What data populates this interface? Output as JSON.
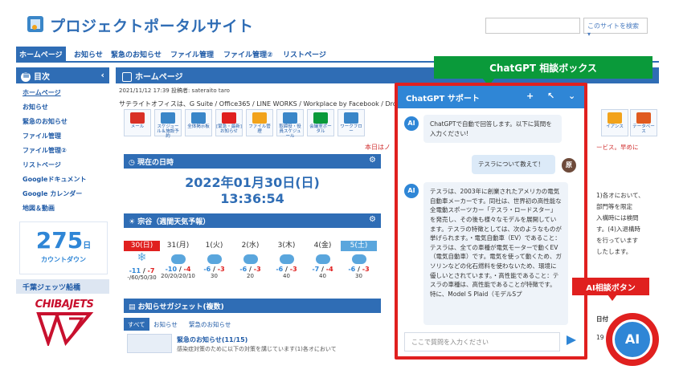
{
  "header": {
    "site_title": "プロジェクトポータルサイト",
    "search_scope": "このサイトを検索 ▾"
  },
  "nav": {
    "items": [
      "ホームページ",
      "お知らせ",
      "緊急のお知らせ",
      "ファイル管理",
      "ファイル管理②",
      "リストページ"
    ],
    "active_index": 0
  },
  "sidebar": {
    "title": "目次",
    "links": [
      "ホームページ",
      "お知らせ",
      "緊急のお知らせ",
      "ファイル管理",
      "ファイル管理②",
      "リストページ",
      "Googleドキュメント",
      "Google カレンダー",
      "地図＆動画"
    ],
    "countdown": {
      "number": "275",
      "unit": "日",
      "label": "カウントダウン"
    },
    "team_title": "千葉ジェッツ船橋",
    "team_logo_text": "CHIBAJETS"
  },
  "main": {
    "title": "ホームページ",
    "post_meta": "2021/11/12 17:39 投稿者: sateraito taro",
    "lead": "サテライトオフィスは、G Suite / Office365 / LINE WORKS / Workplace by Facebook / Drop",
    "apps": [
      "メール",
      "スケジュール＆施設予約",
      "全体掲示板",
      "[緊急・最新]お知らせ",
      "ファイル管理",
      "取締役・役員スケジュール",
      "会議室ポータル",
      "ワークフロー"
    ],
    "notice_red": "本日はノ",
    "clock": {
      "title": "現在の日時",
      "date": "2022年01月30日(日)",
      "time": "13:36:54"
    },
    "weather": {
      "title": "宗谷（週間天気予報）",
      "days": [
        {
          "day": "30(日)",
          "temp_max": "-11",
          "temp_min": "-7",
          "pop": "-/60/50/30"
        },
        {
          "day": "31(月)",
          "temp_max": "-10",
          "temp_min": "-4",
          "pop": "20/20/20/10"
        },
        {
          "day": "1(火)",
          "temp_max": "-6",
          "temp_min": "-3",
          "pop": "30"
        },
        {
          "day": "2(水)",
          "temp_max": "-6",
          "temp_min": "-3",
          "pop": "20"
        },
        {
          "day": "3(木)",
          "temp_max": "-6",
          "temp_min": "-3",
          "pop": "40"
        },
        {
          "day": "4(金)",
          "temp_max": "-7",
          "temp_min": "-4",
          "pop": "40"
        },
        {
          "day": "5(土)",
          "temp_max": "-6",
          "temp_min": "-3",
          "pop": "30"
        }
      ]
    },
    "news": {
      "title": "お知らせガジェット(複数)",
      "tabs": [
        "すべて",
        "お知らせ",
        "緊急のお知らせ"
      ],
      "item_title": "緊急のお知らせ(11/15)",
      "item_body": "感染症対策のために以下の対策を講じています(1)各オにおいて"
    },
    "right_column": [
      "イアンス",
      "テータベース",
      "ービス。早めに",
      "1)各オにおいて、",
      "部門等を限定",
      "入構時には検問",
      "す。(4)入退構時",
      "を行っています",
      "したします。",
      "日付",
      "19"
    ]
  },
  "callouts": {
    "chat_box": "ChatGPT 相談ボックス",
    "ai_button": "AI相談ボタン"
  },
  "chat": {
    "header_title": "ChatGPT サポート",
    "avatar_ai": "AI",
    "avatar_user": "原",
    "messages": [
      {
        "role": "bot",
        "text": "ChatGPTで自動で回答します。以下に質問を入力ください!"
      },
      {
        "role": "user",
        "text": "テスラについて教えて！"
      },
      {
        "role": "bot",
        "text": "テスラは、2003年に創業されたアメリカの電気自動車メーカーです。同社は、世界初の高性能な全電動スポーツカー「テスラ・ロードスター」を発売し、その後も様々なモデルを展開しています。テスラの特徴としては、次のようなものが挙げられます。・電気自動車（EV）であること：テスラは、全ての車種が電気モーターで動くEV（電気自動車）です。電気を使って動くため、ガソリンなどの化石燃料を使わないため、環境に優しいとされています。・高性能であること：テスラの車種は、高性能であることが特徴です。特に、Model S Plaid（モデルSプ"
      }
    ],
    "input_placeholder": "ここで質問を入力ください"
  },
  "ai_button_label": "AI",
  "colors": {
    "brand_blue": "#2f6db5",
    "chat_blue": "#2f86d6",
    "callout_green": "#0a9a3a",
    "highlight_red": "#e0201f"
  }
}
